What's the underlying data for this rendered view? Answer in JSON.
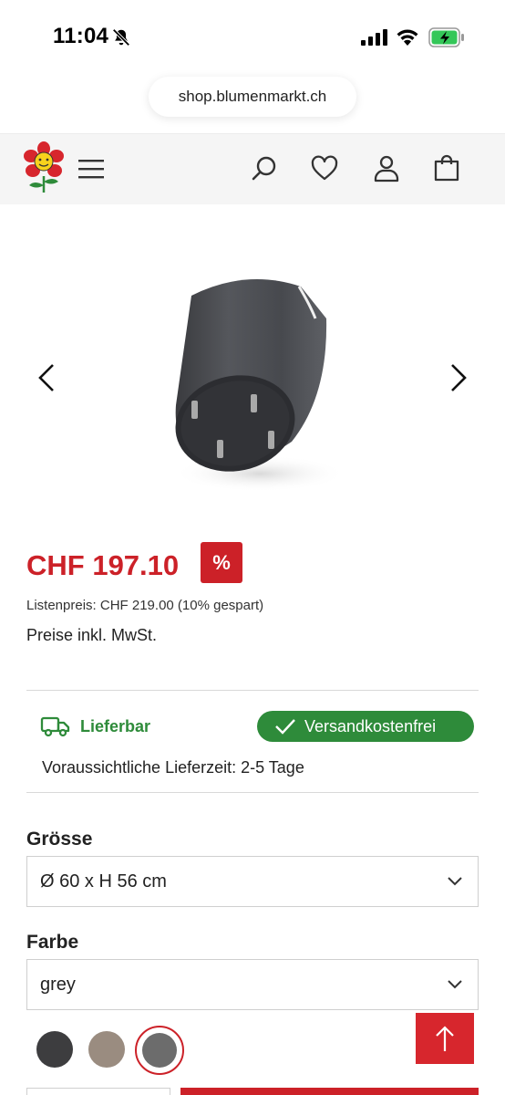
{
  "status_bar": {
    "time": "11:04"
  },
  "browser": {
    "url": "shop.blumenmarkt.ch"
  },
  "product": {
    "price": "CHF 197.10",
    "discount_badge": "%",
    "list_price": "Listenpreis: CHF 219.00 (10% gespart)",
    "vat_note": "Preise inkl. MwSt."
  },
  "availability": {
    "status": "Lieferbar",
    "shipping_badge": "Versandkostenfrei",
    "delivery_time": "Voraussichtliche Lieferzeit: 2-5 Tage"
  },
  "size": {
    "label": "Grösse",
    "selected": "Ø 60 x H 56 cm"
  },
  "color": {
    "label": "Farbe",
    "selected": "grey",
    "swatches": [
      "#3d3d3f",
      "#9a8c80",
      "#6c6c6c"
    ]
  },
  "colors": {
    "accent": "#cc2128",
    "success": "#2e8b3a",
    "header_bg": "#f5f5f5"
  }
}
